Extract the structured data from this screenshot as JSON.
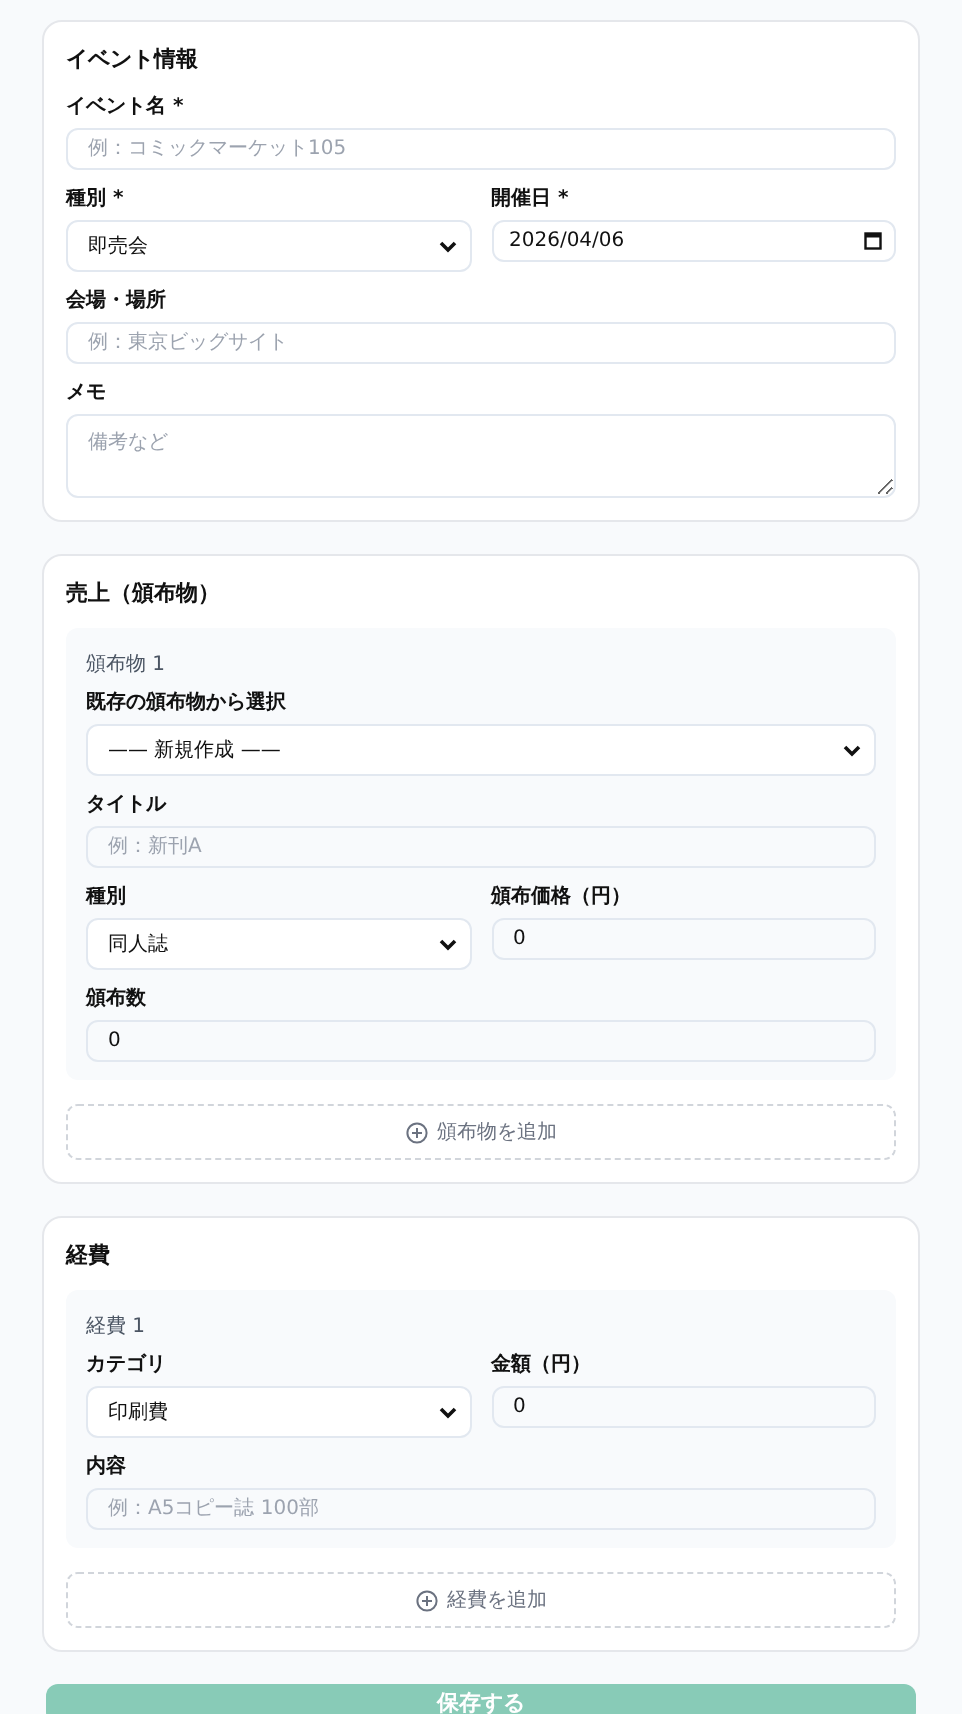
{
  "sections": [
    {
      "title": "イベント情報",
      "rows": [
        [
          {
            "kind": "text",
            "label": "イベント名 *",
            "placeholder": "例：コミックマーケット105"
          }
        ],
        [
          {
            "kind": "select",
            "label": "種別 *",
            "value": "即売会"
          },
          {
            "kind": "date",
            "label": "開催日 *",
            "value": "2026/04/06"
          }
        ],
        [
          {
            "kind": "text",
            "label": "会場・場所",
            "placeholder": "例：東京ビッグサイト"
          }
        ],
        [
          {
            "kind": "textarea",
            "label": "メモ",
            "placeholder": "備考など"
          }
        ]
      ]
    },
    {
      "title": "売上（頒布物）",
      "items": [
        {
          "heading": "頒布物 1",
          "rows": [
            [
              {
                "kind": "select",
                "label": "既存の頒布物から選択",
                "value": "—— 新規作成 ——"
              }
            ],
            [
              {
                "kind": "text",
                "label": "タイトル",
                "placeholder": "例：新刊A"
              }
            ],
            [
              {
                "kind": "select",
                "label": "種別",
                "value": "同人誌"
              },
              {
                "kind": "text",
                "label": "頒布価格（円）",
                "value": "0"
              }
            ],
            [
              {
                "kind": "text",
                "label": "頒布数",
                "value": "0"
              }
            ]
          ]
        }
      ],
      "add_button": "頒布物を追加"
    },
    {
      "title": "経費",
      "items": [
        {
          "heading": "経費 1",
          "rows": [
            [
              {
                "kind": "select",
                "label": "カテゴリ",
                "value": "印刷費"
              },
              {
                "kind": "text",
                "label": "金額（円）",
                "value": "0"
              }
            ],
            [
              {
                "kind": "text",
                "label": "内容",
                "placeholder": "例：A5コピー誌 100部"
              }
            ]
          ]
        }
      ],
      "add_button": "経費を追加"
    }
  ],
  "save_button": "保存する"
}
